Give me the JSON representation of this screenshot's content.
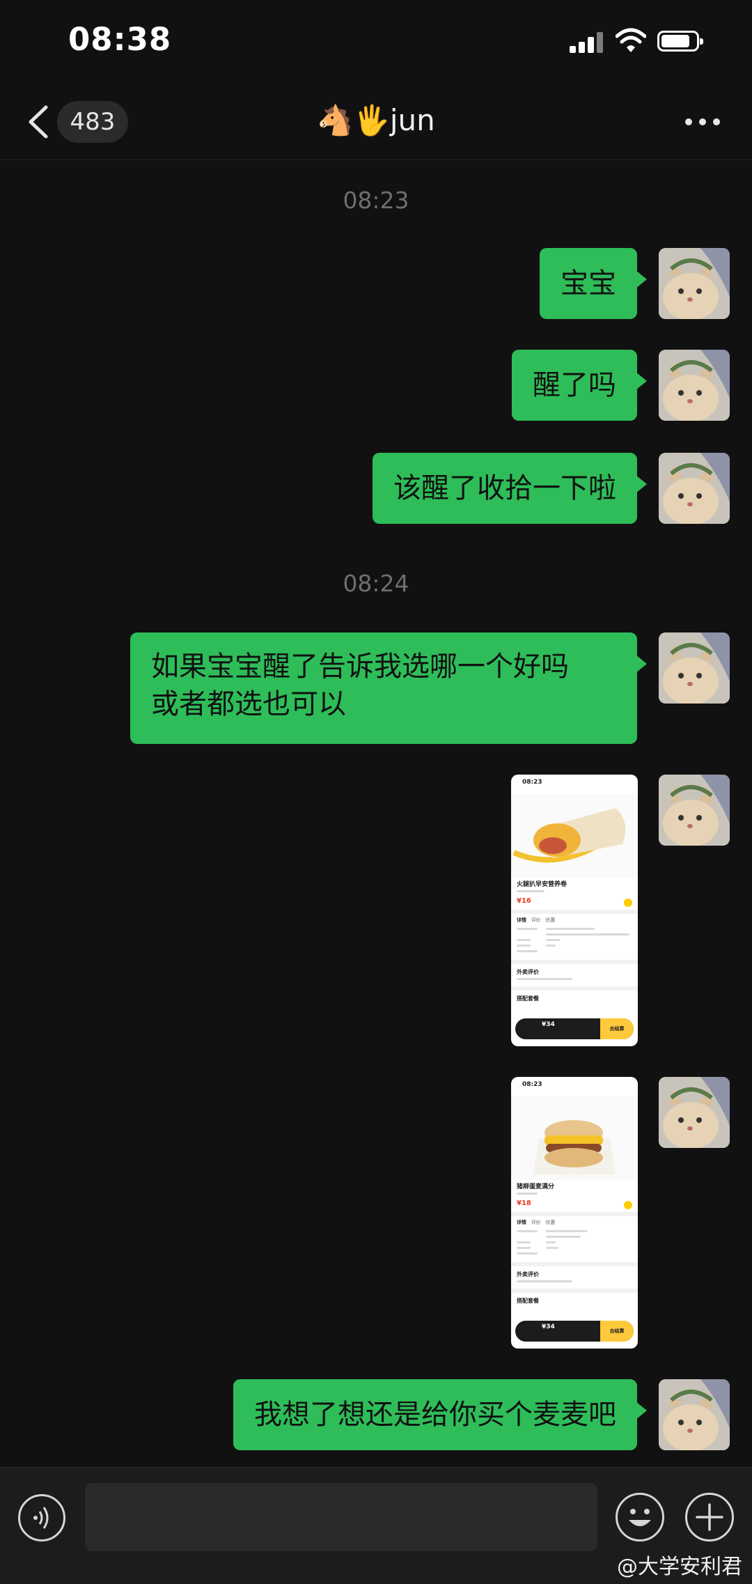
{
  "status_bar": {
    "time": "08:38"
  },
  "header": {
    "unread_count": "483",
    "title": "🐴🖐jun"
  },
  "timestamps": [
    "08:23",
    "08:24"
  ],
  "messages": [
    {
      "text": "宝宝"
    },
    {
      "text": "醒了吗"
    },
    {
      "text": "该醒了收拾一下啦"
    },
    {
      "line1": "如果宝宝醒了告诉我选哪一个好吗",
      "line2": "或者都选也可以"
    },
    {
      "text": "我想了想还是给你买个麦麦吧"
    }
  ],
  "image_messages": [
    {
      "time": "08:23",
      "item_name": "火腿扒早安营养卷",
      "price": "¥16",
      "tab_details": "详情",
      "tab_reviews": "评价",
      "tab_deals": "优惠",
      "section_reviews": "外卖评价",
      "section_combo": "搭配套餐",
      "cart_price": "¥34",
      "checkout": "去结算"
    },
    {
      "time": "08:23",
      "item_name": "猪柳蛋麦满分",
      "price": "¥18",
      "tab_details": "详情",
      "tab_reviews": "评价",
      "tab_deals": "优惠",
      "section_reviews": "外卖评价",
      "section_combo": "搭配套餐",
      "cart_price": "¥34",
      "checkout": "去结算"
    }
  ],
  "watermark": "@大学安利君",
  "colors": {
    "bubble": "#2ebd59",
    "background": "#111111",
    "timestamp": "#6e6e6e"
  }
}
